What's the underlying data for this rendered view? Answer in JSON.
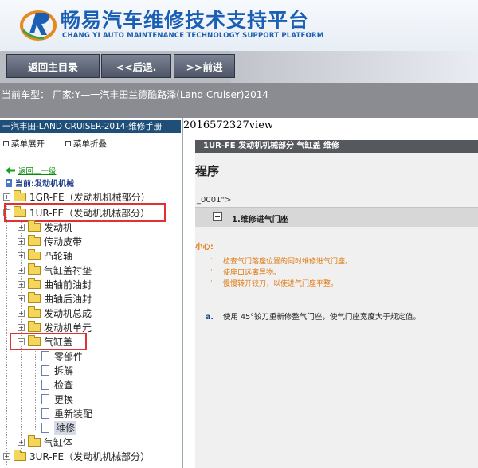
{
  "header": {
    "title": "畅易汽车维修技术支持平台",
    "subtitle": "CHANG YI AUTO MAINTENANCE TECHNOLOGY SUPPORT PLATFORM"
  },
  "toolbar": {
    "home_label": "返回主目录",
    "back_label": "<<后退.",
    "forward_label": ">>前进"
  },
  "model_bar": {
    "text": "当前车型： 厂家:Y—一汽丰田兰德酷路泽(Land Cruiser)2014"
  },
  "sidebar": {
    "manual_title": "一汽丰田-LAND CRUISER-2014-维修手册",
    "expand_label": "菜单展开",
    "collapse_label": "菜单折叠",
    "back_up_label": "返回上一级",
    "current_label": "当前:发动机机械",
    "tree": {
      "n1gr": "1GR-FE（发动机机械部分）",
      "n1ur": "1UR-FE（发动机机械部分）",
      "engine": "发动机",
      "belt": "传动皮带",
      "camshaft": "凸轮轴",
      "gasket": "气缸盖衬垫",
      "front_seal": "曲轴前油封",
      "rear_seal": "曲轴后油封",
      "assembly": "发动机总成",
      "unit": "发动机单元",
      "head": "气缸盖",
      "parts": "零部件",
      "disassembly": "拆解",
      "inspection": "检查",
      "replace": "更换",
      "reassembly": "重新装配",
      "repair": "维修",
      "block": "气缸体",
      "n3ur": "3UR-FE（发动机机械部分）"
    }
  },
  "content": {
    "view_id": "2016572327view",
    "section_title": "1UR-FE 发动机机械部分  气缸盖  维修",
    "procedure_title": "程序",
    "code": "_0001\">",
    "step_title": "1.维修进气门座",
    "caution_label": "小心:",
    "caution_items": [
      "检查气门落座位置的同时维修进气门座。",
      "使座口远离异物。",
      "慢慢转开铰刀，以使进气门座平整。"
    ],
    "instruction_marker": "a.",
    "instruction_text": "使用 45°铰刀重新修整气门座，使气门座宽度大于规定值。"
  },
  "colors": {
    "brand_blue": "#1a5fb4",
    "caution_orange": "#e07810",
    "highlight_red": "#dd3333"
  }
}
